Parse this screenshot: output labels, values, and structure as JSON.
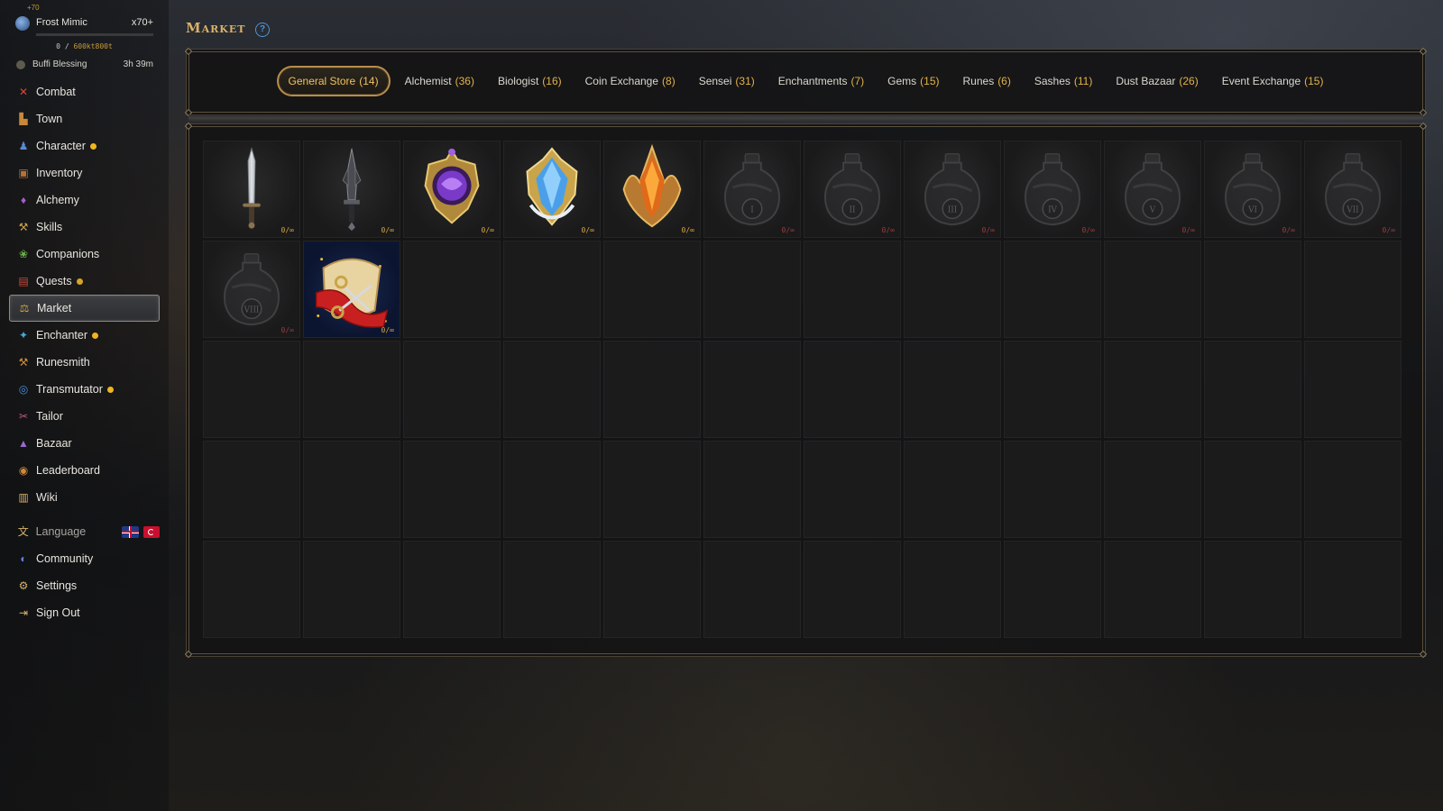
{
  "boss": {
    "plus": "+70",
    "name": "Frost Mimic",
    "multiplier": "x70+",
    "hp_current": "0",
    "hp_total": "600kt800t",
    "progress": 0
  },
  "buff": {
    "name": "Buffi Blessing",
    "time": "3h 39m"
  },
  "nav": {
    "items": [
      {
        "label": "Combat"
      },
      {
        "label": "Town"
      },
      {
        "label": "Character"
      },
      {
        "label": "Inventory"
      },
      {
        "label": "Alchemy"
      },
      {
        "label": "Skills"
      },
      {
        "label": "Companions"
      },
      {
        "label": "Quests"
      },
      {
        "label": "Market"
      },
      {
        "label": "Enchanter"
      },
      {
        "label": "Runesmith"
      },
      {
        "label": "Transmutator"
      },
      {
        "label": "Tailor"
      },
      {
        "label": "Bazaar"
      },
      {
        "label": "Leaderboard"
      },
      {
        "label": "Wiki"
      }
    ],
    "language_label": "Language",
    "community": "Community",
    "settings": "Settings",
    "sign_out": "Sign Out"
  },
  "header": {
    "title": "Market",
    "help": "?"
  },
  "tabs": [
    {
      "label": "General Store",
      "count": "(14)"
    },
    {
      "label": "Alchemist",
      "count": "(36)"
    },
    {
      "label": "Biologist",
      "count": "(16)"
    },
    {
      "label": "Coin Exchange",
      "count": "(8)"
    },
    {
      "label": "Sensei",
      "count": "(31)"
    },
    {
      "label": "Enchantments",
      "count": "(7)"
    },
    {
      "label": "Gems",
      "count": "(15)"
    },
    {
      "label": "Runes",
      "count": "(6)"
    },
    {
      "label": "Sashes",
      "count": "(11)"
    },
    {
      "label": "Dust Bazaar",
      "count": "(26)"
    },
    {
      "label": "Event Exchange",
      "count": "(15)"
    }
  ],
  "items": [
    {
      "icon": "dagger-icon",
      "qty": "0/∞"
    },
    {
      "icon": "dark-dagger-icon",
      "qty": "0/∞"
    },
    {
      "icon": "purple-emblem-icon",
      "qty": "0/∞"
    },
    {
      "icon": "blue-crystal-emblem-icon",
      "qty": "0/∞"
    },
    {
      "icon": "fire-crystal-emblem-icon",
      "qty": "0/∞"
    },
    {
      "icon": "potion-i-icon",
      "qty": "0/∞",
      "numeral": "I"
    },
    {
      "icon": "potion-ii-icon",
      "qty": "0/∞",
      "numeral": "II"
    },
    {
      "icon": "potion-iii-icon",
      "qty": "0/∞",
      "numeral": "III"
    },
    {
      "icon": "potion-iv-icon",
      "qty": "0/∞",
      "numeral": "IV"
    },
    {
      "icon": "potion-v-icon",
      "qty": "0/∞",
      "numeral": "V"
    },
    {
      "icon": "potion-vi-icon",
      "qty": "0/∞",
      "numeral": "VI"
    },
    {
      "icon": "potion-vii-icon",
      "qty": "0/∞",
      "numeral": "VII"
    },
    {
      "icon": "potion-viii-icon",
      "qty": "0/∞",
      "numeral": "VIII"
    },
    {
      "icon": "scroll-scissors-icon",
      "qty": "0/∞"
    }
  ],
  "colors": {
    "accent": "#e2b24a",
    "notify_dot": "#f0b620",
    "locked_qty": "#9b3c3c"
  }
}
